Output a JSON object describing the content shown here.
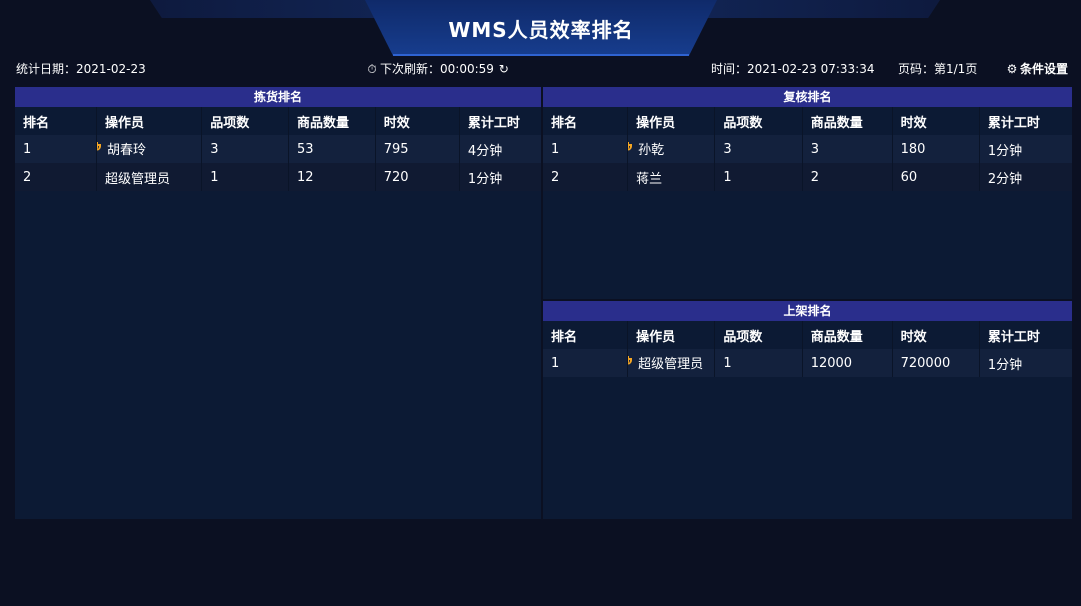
{
  "header": {
    "title": "WMS人员效率排名",
    "stat_date_label": "统计日期：",
    "stat_date": "2021-02-23",
    "refresh_label": "下次刷新：",
    "refresh_time": "00:00:59",
    "time_label": "时间：",
    "time": "2021-02-23 07:33:34",
    "page_label": "页码：第1/1页",
    "settings_label": "条件设置"
  },
  "colors": {
    "panel_title": "#2a2e8c",
    "background": "#0b1022",
    "panel": "#0c1a34",
    "trophy": "#f5a623"
  },
  "picking": {
    "title": "拣货排名",
    "columns": [
      "排名",
      "操作员",
      "品项数",
      "商品数量",
      "时效",
      "累计工时"
    ],
    "rows": [
      {
        "rank": "1",
        "operator": "胡春玲",
        "items": "3",
        "qty": "53",
        "eff": "795",
        "hours": "4分钟",
        "trophy": true
      },
      {
        "rank": "2",
        "operator": "超级管理员",
        "items": "1",
        "qty": "12",
        "eff": "720",
        "hours": "1分钟",
        "trophy": false
      }
    ]
  },
  "review": {
    "title": "复核排名",
    "columns": [
      "排名",
      "操作员",
      "品项数",
      "商品数量",
      "时效",
      "累计工时"
    ],
    "rows": [
      {
        "rank": "1",
        "operator": "孙乾",
        "items": "3",
        "qty": "3",
        "eff": "180",
        "hours": "1分钟",
        "trophy": true
      },
      {
        "rank": "2",
        "operator": "蒋兰",
        "items": "1",
        "qty": "2",
        "eff": "60",
        "hours": "2分钟",
        "trophy": false
      }
    ]
  },
  "shelving": {
    "title": "上架排名",
    "columns": [
      "排名",
      "操作员",
      "品项数",
      "商品数量",
      "时效",
      "累计工时"
    ],
    "rows": [
      {
        "rank": "1",
        "operator": "超级管理员",
        "items": "1",
        "qty": "12000",
        "eff": "720000",
        "hours": "1分钟",
        "trophy": true
      }
    ]
  }
}
